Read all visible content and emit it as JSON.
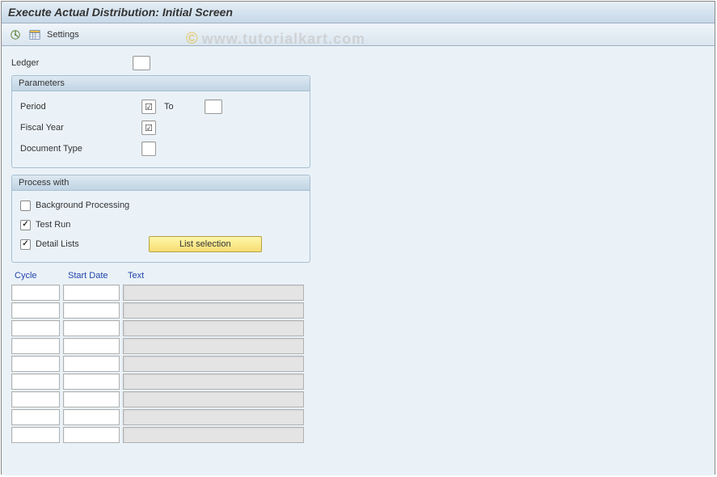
{
  "title": "Execute Actual Distribution: Initial Screen",
  "toolbar": {
    "execute_icon": "execute",
    "settings_icon": "settings",
    "settings_label": "Settings"
  },
  "ledger": {
    "label": "Ledger",
    "value": ""
  },
  "parameters": {
    "title": "Parameters",
    "period_label": "Period",
    "period_from": "",
    "to_label": "To",
    "period_to": "",
    "fiscal_year_label": "Fiscal Year",
    "fiscal_year": "",
    "doc_type_label": "Document Type",
    "doc_type": ""
  },
  "process": {
    "title": "Process with",
    "background_label": "Background Processing",
    "background_checked": false,
    "test_run_label": "Test Run",
    "test_run_checked": true,
    "detail_lists_label": "Detail Lists",
    "detail_lists_checked": true,
    "list_selection_btn": "List selection"
  },
  "table": {
    "headers": {
      "cycle": "Cycle",
      "start_date": "Start Date",
      "text": "Text"
    },
    "rows": [
      {
        "cycle": "",
        "start_date": "",
        "text": ""
      },
      {
        "cycle": "",
        "start_date": "",
        "text": ""
      },
      {
        "cycle": "",
        "start_date": "",
        "text": ""
      },
      {
        "cycle": "",
        "start_date": "",
        "text": ""
      },
      {
        "cycle": "",
        "start_date": "",
        "text": ""
      },
      {
        "cycle": "",
        "start_date": "",
        "text": ""
      },
      {
        "cycle": "",
        "start_date": "",
        "text": ""
      },
      {
        "cycle": "",
        "start_date": "",
        "text": ""
      },
      {
        "cycle": "",
        "start_date": "",
        "text": ""
      }
    ]
  },
  "watermark": {
    "copyright": "©",
    "text": "www.tutorialkart.com"
  }
}
